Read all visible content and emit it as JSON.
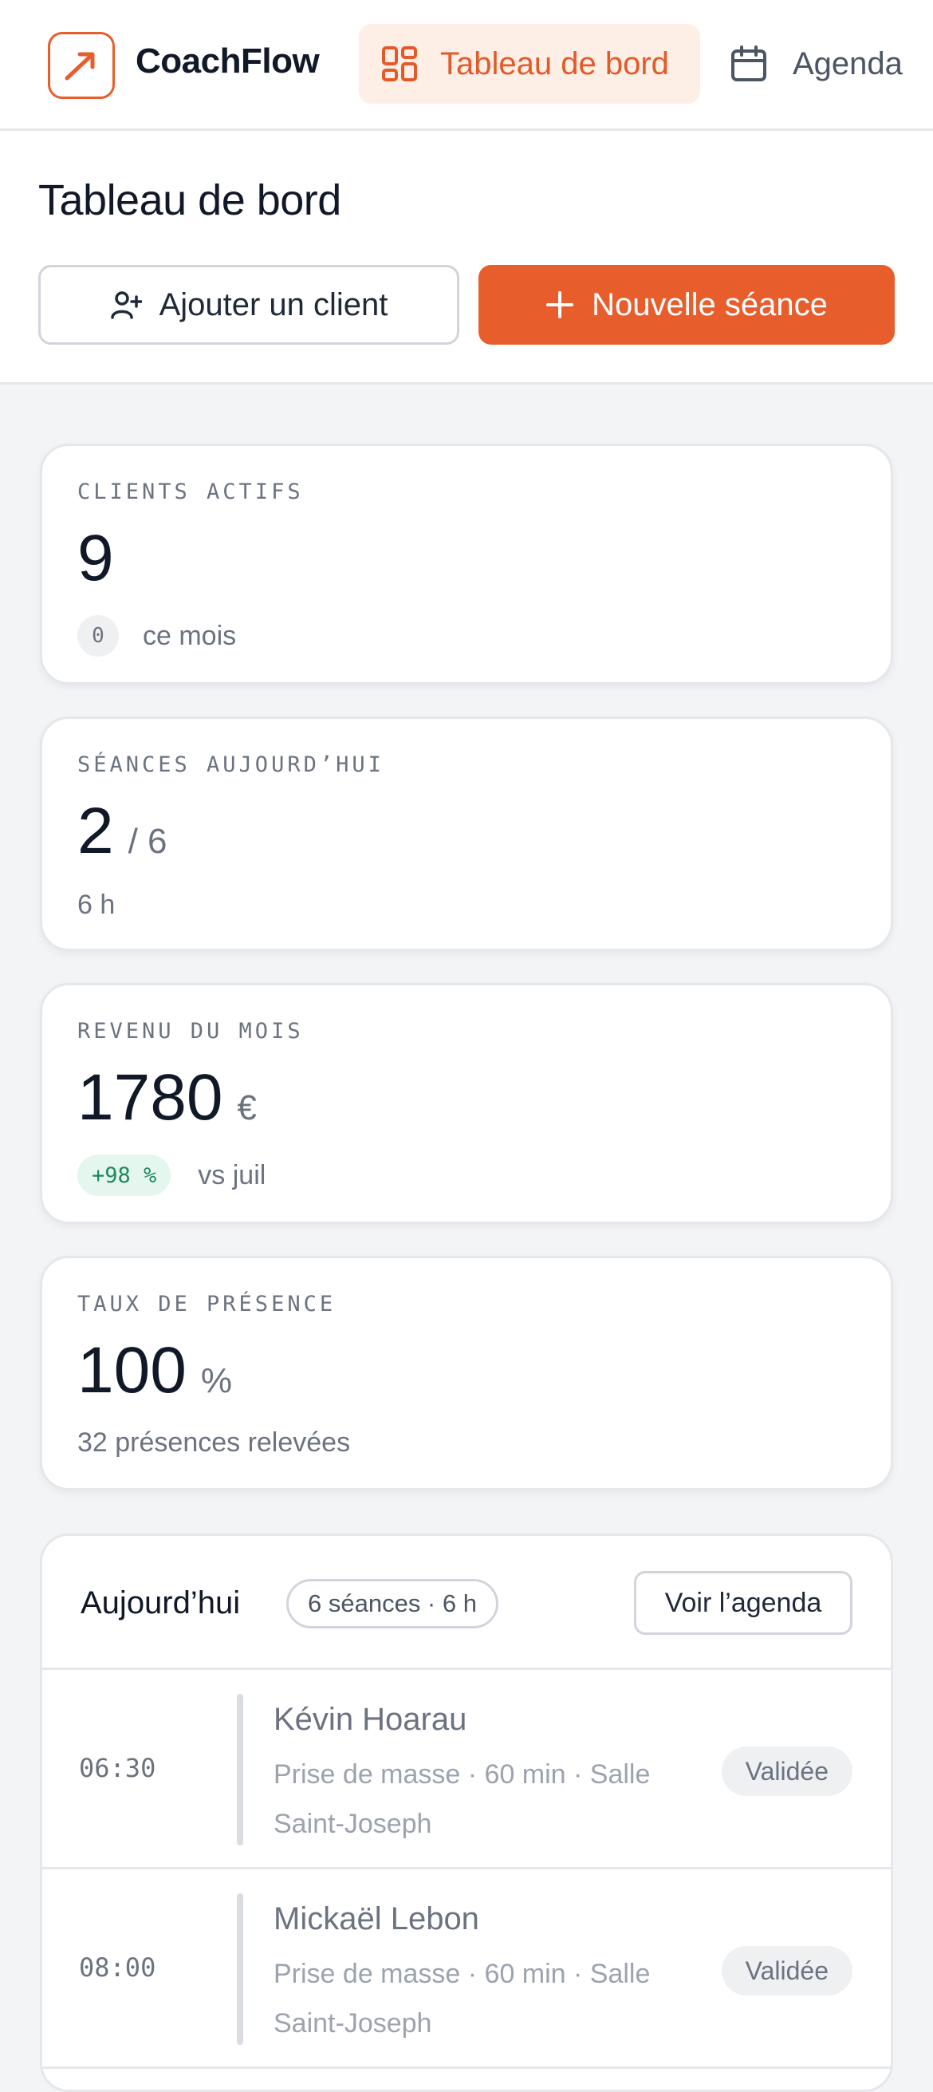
{
  "app": {
    "name": "CoachFlow"
  },
  "nav": {
    "items": [
      {
        "label": "Tableau de bord",
        "icon": "grid-icon",
        "active": true
      },
      {
        "label": "Agenda",
        "icon": "calendar-icon",
        "active": false
      }
    ]
  },
  "header": {
    "title": "Tableau de bord",
    "add_client_label": "Ajouter un client",
    "new_session_label": "Nouvelle séance"
  },
  "stats": {
    "clients": {
      "label": "CLIENTS ACTIFS",
      "value": "9",
      "delta": "0",
      "delta_label": "ce mois"
    },
    "sessions": {
      "label": "SÉANCES AUJOURD’HUI",
      "value": "2",
      "total": "/ 6",
      "sub": "6 h"
    },
    "revenue": {
      "label": "REVENU DU MOIS",
      "value": "1780",
      "unit": "€",
      "delta": "+98 %",
      "delta_label": "vs juil"
    },
    "attendance": {
      "label": "TAUX DE PRÉSENCE",
      "value": "100",
      "unit": "%",
      "sub": "32 présences relevées"
    }
  },
  "today": {
    "title": "Aujourd’hui",
    "badge": "6 séances · 6 h",
    "agenda_button": "Voir l’agenda",
    "sessions": [
      {
        "time": "06:30",
        "name": "Kévin Hoarau",
        "desc": "Prise de masse · 60 min · Salle Saint-Joseph",
        "status": "Validée"
      },
      {
        "time": "08:00",
        "name": "Mickaël Lebon",
        "desc": "Prise de masse · 60 min · Salle Saint-Joseph",
        "status": "Validée"
      }
    ]
  },
  "colors": {
    "accent": "#e85d2c",
    "accent_soft": "#fdeee6",
    "success": "#1d8a5a",
    "success_soft": "#e5f6ee"
  }
}
